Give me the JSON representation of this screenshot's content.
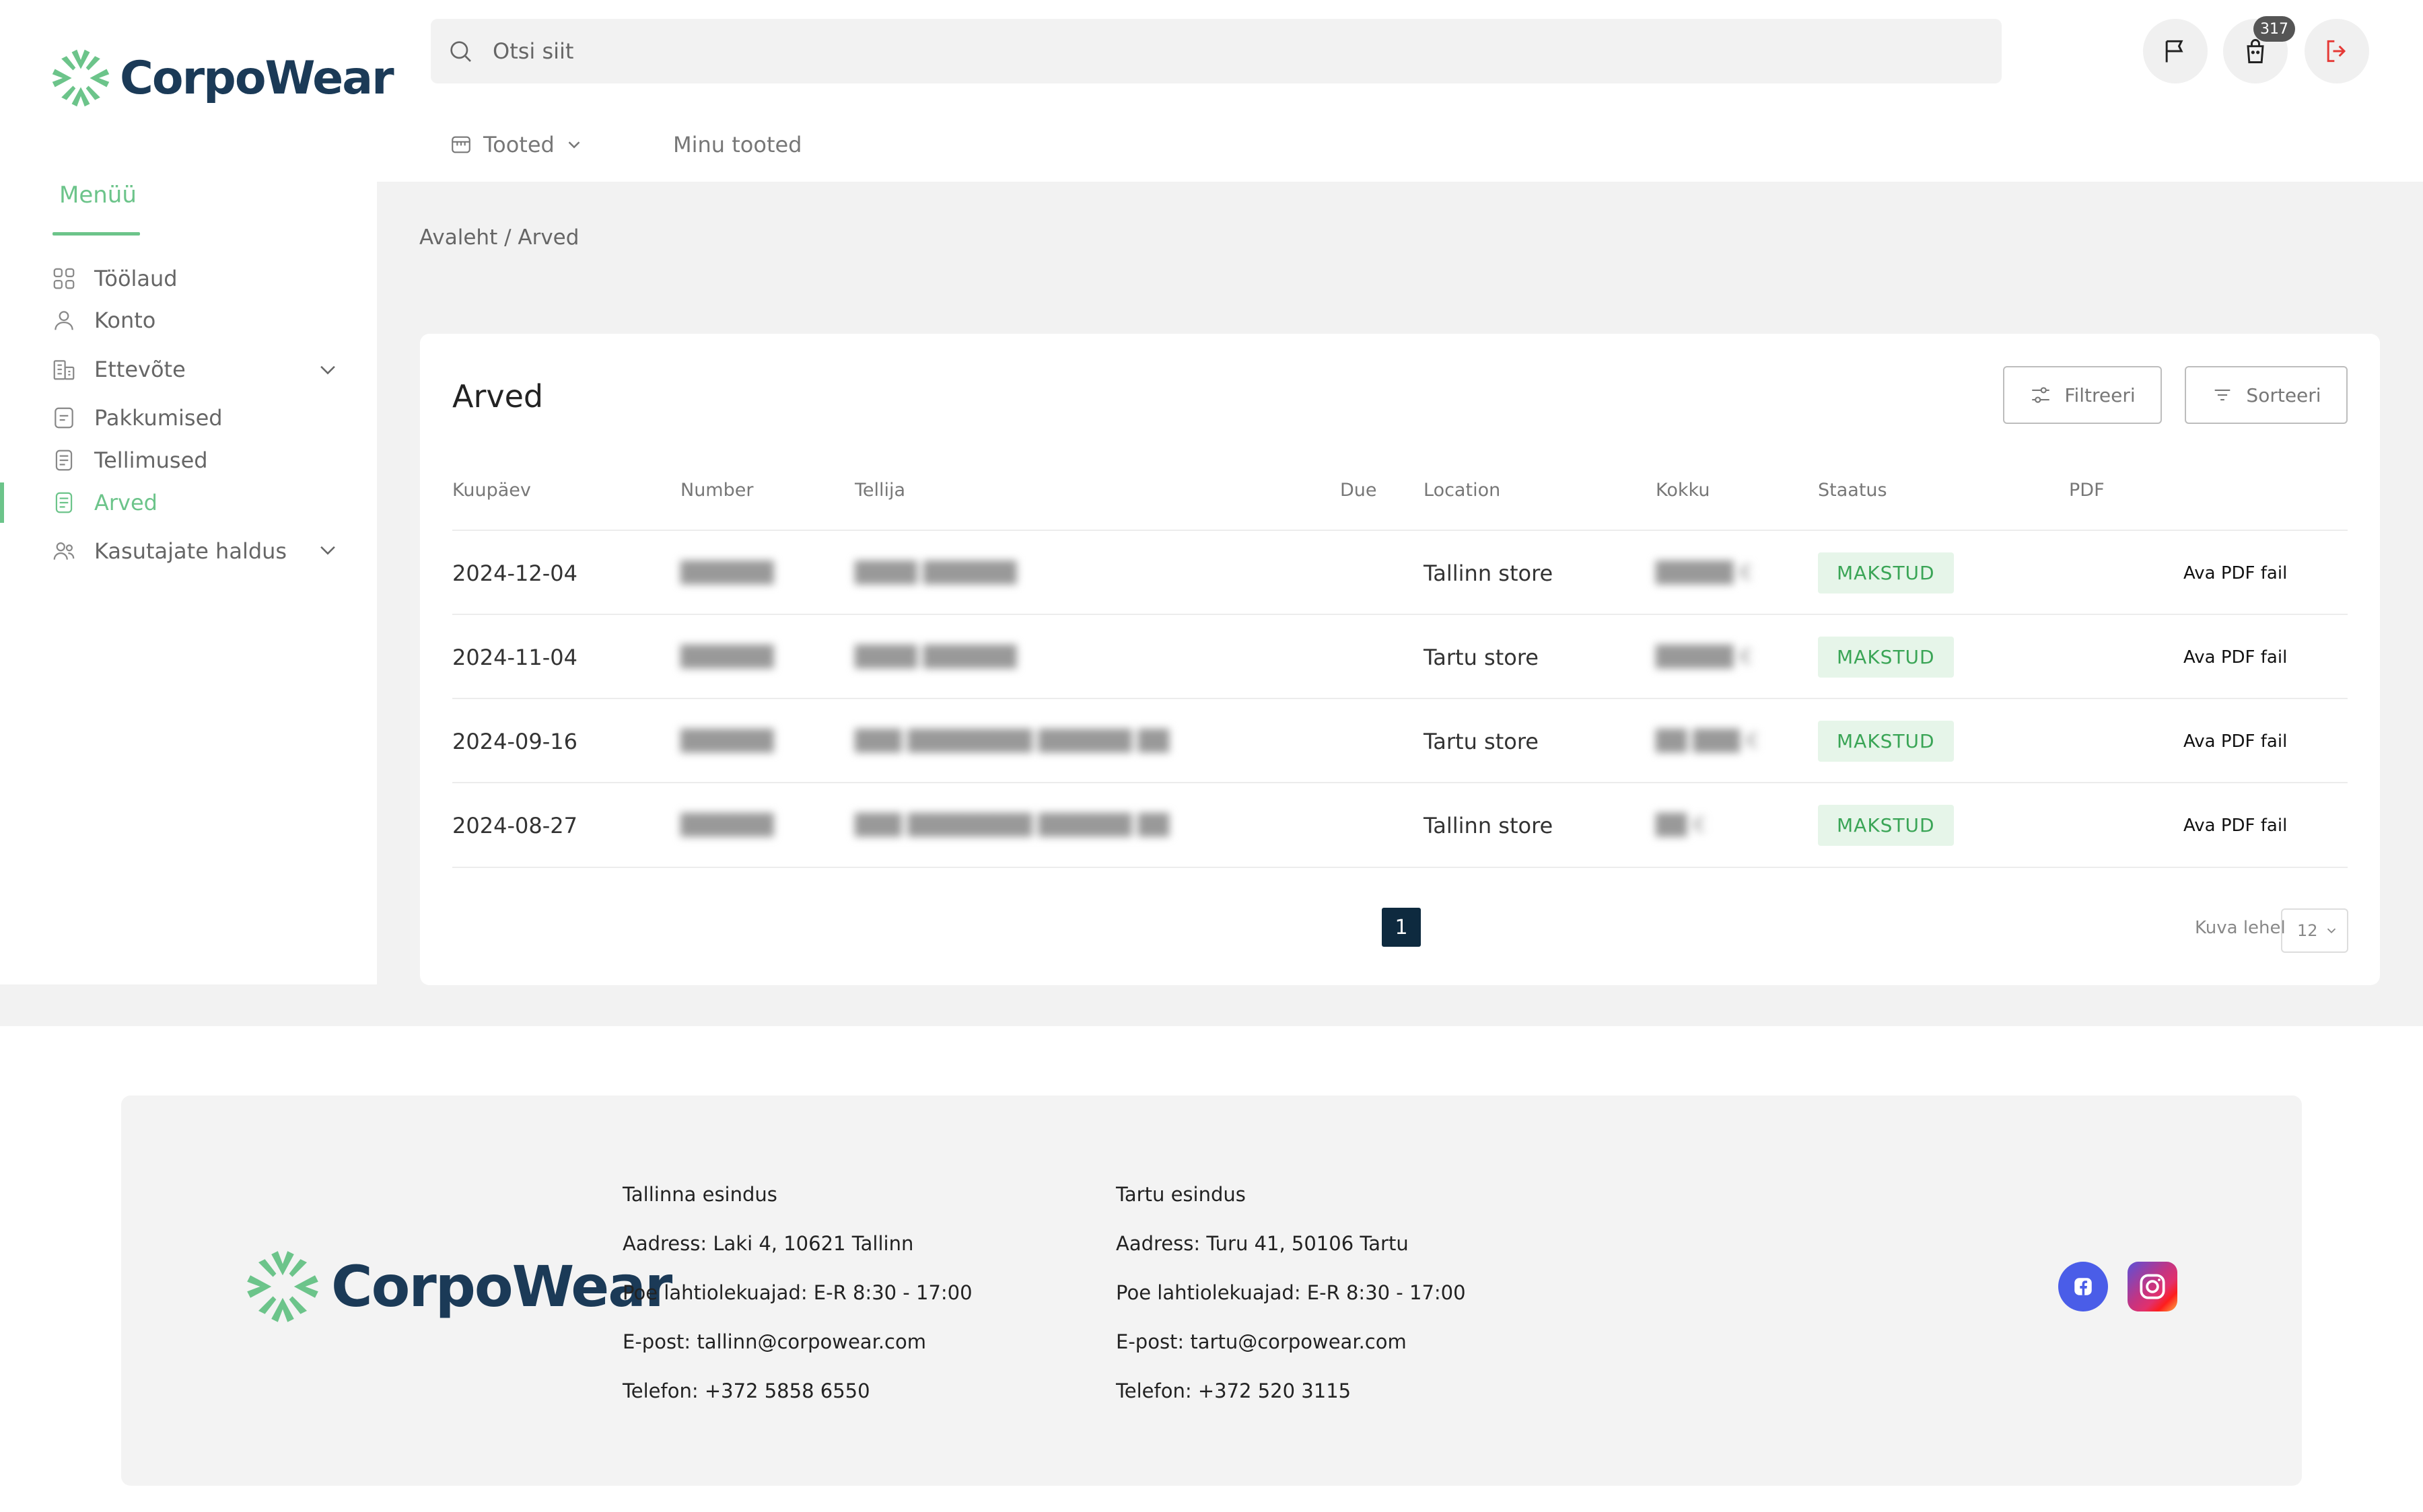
{
  "brand": {
    "name": "CorpoWear"
  },
  "colors": {
    "accent": "#6cc48a",
    "navy": "#1b3a57",
    "paid_bg": "#e6f5e9",
    "paid_text": "#3aa556",
    "logout": "#e53935"
  },
  "search": {
    "placeholder": "Otsi siit"
  },
  "header": {
    "cart_count": "317",
    "tabs": [
      {
        "label": "Tooted",
        "icon": "store-icon"
      },
      {
        "label": "Minu tooted"
      }
    ]
  },
  "sidebar": {
    "title": "Menüü",
    "items": [
      {
        "label": "Töölaud",
        "icon": "dashboard-icon"
      },
      {
        "label": "Konto",
        "icon": "user-icon"
      },
      {
        "label": "Ettevõte",
        "icon": "company-icon",
        "expandable": true
      },
      {
        "label": "Pakkumised",
        "icon": "document-icon"
      },
      {
        "label": "Tellimused",
        "icon": "document-icon"
      },
      {
        "label": "Arved",
        "icon": "invoice-icon",
        "active": true
      },
      {
        "label": "Kasutajate haldus",
        "icon": "users-icon",
        "expandable": true
      }
    ]
  },
  "breadcrumb": "Avaleht / Arved",
  "main": {
    "title": "Arved",
    "filter_label": "Filtreeri",
    "sort_label": "Sorteeri",
    "columns": [
      "Kuupäev",
      "Number",
      "Tellija",
      "Due",
      "Location",
      "Kokku",
      "Staatus",
      "PDF"
    ],
    "rows": [
      {
        "date": "2024-12-04",
        "number": "",
        "client": "",
        "due": "",
        "location": "Tallinn store",
        "total": "",
        "status": "MAKSTUD",
        "pdf": "Ava PDF fail"
      },
      {
        "date": "2024-11-04",
        "number": "",
        "client": "",
        "due": "",
        "location": "Tartu store",
        "total": "",
        "status": "MAKSTUD",
        "pdf": "Ava PDF fail"
      },
      {
        "date": "2024-09-16",
        "number": "",
        "client": "",
        "due": "",
        "location": "Tartu store",
        "total": "",
        "status": "MAKSTUD",
        "pdf": "Ava PDF fail"
      },
      {
        "date": "2024-08-27",
        "number": "",
        "client": "",
        "due": "",
        "location": "Tallinn store",
        "total": "",
        "status": "MAKSTUD",
        "pdf": "Ava PDF fail"
      }
    ],
    "pagination": {
      "current_page": "1",
      "per_page_label": "Kuva lehel",
      "per_page_value": "12"
    }
  },
  "footer": {
    "offices": [
      {
        "title": "Tallinna esindus",
        "address": "Aadress: Laki 4, 10621 Tallinn",
        "hours": "Poe lahtiolekuajad: E-R 8:30 - 17:00",
        "email": "E-post: tallinn@corpowear.com",
        "phone": "Telefon: +372 5858 6550"
      },
      {
        "title": "Tartu esindus",
        "address": "Aadress: Turu 41, 50106 Tartu",
        "hours": "Poe lahtiolekuajad: E-R 8:30 - 17:00",
        "email": "E-post: tartu@corpowear.com",
        "phone": "Telefon: +372 520 3115"
      }
    ],
    "social": [
      {
        "icon": "facebook-icon",
        "color": "#4a5de8"
      },
      {
        "icon": "instagram-icon"
      }
    ]
  }
}
